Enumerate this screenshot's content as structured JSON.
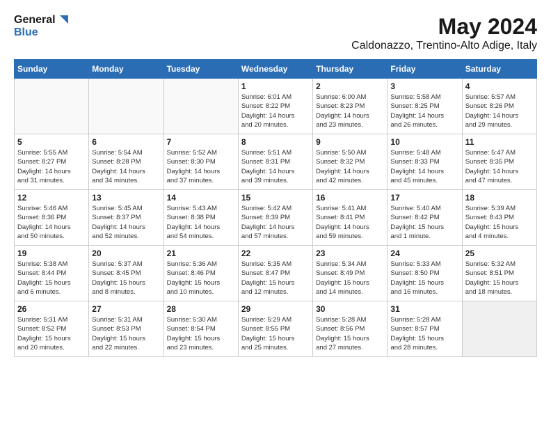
{
  "logo": {
    "line1": "General",
    "line2": "Blue"
  },
  "title": "May 2024",
  "subtitle": "Caldonazzo, Trentino-Alto Adige, Italy",
  "headers": [
    "Sunday",
    "Monday",
    "Tuesday",
    "Wednesday",
    "Thursday",
    "Friday",
    "Saturday"
  ],
  "weeks": [
    [
      {
        "day": "",
        "info": ""
      },
      {
        "day": "",
        "info": ""
      },
      {
        "day": "",
        "info": ""
      },
      {
        "day": "1",
        "info": "Sunrise: 6:01 AM\nSunset: 8:22 PM\nDaylight: 14 hours\nand 20 minutes."
      },
      {
        "day": "2",
        "info": "Sunrise: 6:00 AM\nSunset: 8:23 PM\nDaylight: 14 hours\nand 23 minutes."
      },
      {
        "day": "3",
        "info": "Sunrise: 5:58 AM\nSunset: 8:25 PM\nDaylight: 14 hours\nand 26 minutes."
      },
      {
        "day": "4",
        "info": "Sunrise: 5:57 AM\nSunset: 8:26 PM\nDaylight: 14 hours\nand 29 minutes."
      }
    ],
    [
      {
        "day": "5",
        "info": "Sunrise: 5:55 AM\nSunset: 8:27 PM\nDaylight: 14 hours\nand 31 minutes."
      },
      {
        "day": "6",
        "info": "Sunrise: 5:54 AM\nSunset: 8:28 PM\nDaylight: 14 hours\nand 34 minutes."
      },
      {
        "day": "7",
        "info": "Sunrise: 5:52 AM\nSunset: 8:30 PM\nDaylight: 14 hours\nand 37 minutes."
      },
      {
        "day": "8",
        "info": "Sunrise: 5:51 AM\nSunset: 8:31 PM\nDaylight: 14 hours\nand 39 minutes."
      },
      {
        "day": "9",
        "info": "Sunrise: 5:50 AM\nSunset: 8:32 PM\nDaylight: 14 hours\nand 42 minutes."
      },
      {
        "day": "10",
        "info": "Sunrise: 5:48 AM\nSunset: 8:33 PM\nDaylight: 14 hours\nand 45 minutes."
      },
      {
        "day": "11",
        "info": "Sunrise: 5:47 AM\nSunset: 8:35 PM\nDaylight: 14 hours\nand 47 minutes."
      }
    ],
    [
      {
        "day": "12",
        "info": "Sunrise: 5:46 AM\nSunset: 8:36 PM\nDaylight: 14 hours\nand 50 minutes."
      },
      {
        "day": "13",
        "info": "Sunrise: 5:45 AM\nSunset: 8:37 PM\nDaylight: 14 hours\nand 52 minutes."
      },
      {
        "day": "14",
        "info": "Sunrise: 5:43 AM\nSunset: 8:38 PM\nDaylight: 14 hours\nand 54 minutes."
      },
      {
        "day": "15",
        "info": "Sunrise: 5:42 AM\nSunset: 8:39 PM\nDaylight: 14 hours\nand 57 minutes."
      },
      {
        "day": "16",
        "info": "Sunrise: 5:41 AM\nSunset: 8:41 PM\nDaylight: 14 hours\nand 59 minutes."
      },
      {
        "day": "17",
        "info": "Sunrise: 5:40 AM\nSunset: 8:42 PM\nDaylight: 15 hours\nand 1 minute."
      },
      {
        "day": "18",
        "info": "Sunrise: 5:39 AM\nSunset: 8:43 PM\nDaylight: 15 hours\nand 4 minutes."
      }
    ],
    [
      {
        "day": "19",
        "info": "Sunrise: 5:38 AM\nSunset: 8:44 PM\nDaylight: 15 hours\nand 6 minutes."
      },
      {
        "day": "20",
        "info": "Sunrise: 5:37 AM\nSunset: 8:45 PM\nDaylight: 15 hours\nand 8 minutes."
      },
      {
        "day": "21",
        "info": "Sunrise: 5:36 AM\nSunset: 8:46 PM\nDaylight: 15 hours\nand 10 minutes."
      },
      {
        "day": "22",
        "info": "Sunrise: 5:35 AM\nSunset: 8:47 PM\nDaylight: 15 hours\nand 12 minutes."
      },
      {
        "day": "23",
        "info": "Sunrise: 5:34 AM\nSunset: 8:49 PM\nDaylight: 15 hours\nand 14 minutes."
      },
      {
        "day": "24",
        "info": "Sunrise: 5:33 AM\nSunset: 8:50 PM\nDaylight: 15 hours\nand 16 minutes."
      },
      {
        "day": "25",
        "info": "Sunrise: 5:32 AM\nSunset: 8:51 PM\nDaylight: 15 hours\nand 18 minutes."
      }
    ],
    [
      {
        "day": "26",
        "info": "Sunrise: 5:31 AM\nSunset: 8:52 PM\nDaylight: 15 hours\nand 20 minutes."
      },
      {
        "day": "27",
        "info": "Sunrise: 5:31 AM\nSunset: 8:53 PM\nDaylight: 15 hours\nand 22 minutes."
      },
      {
        "day": "28",
        "info": "Sunrise: 5:30 AM\nSunset: 8:54 PM\nDaylight: 15 hours\nand 23 minutes."
      },
      {
        "day": "29",
        "info": "Sunrise: 5:29 AM\nSunset: 8:55 PM\nDaylight: 15 hours\nand 25 minutes."
      },
      {
        "day": "30",
        "info": "Sunrise: 5:28 AM\nSunset: 8:56 PM\nDaylight: 15 hours\nand 27 minutes."
      },
      {
        "day": "31",
        "info": "Sunrise: 5:28 AM\nSunset: 8:57 PM\nDaylight: 15 hours\nand 28 minutes."
      },
      {
        "day": "",
        "info": ""
      }
    ]
  ]
}
